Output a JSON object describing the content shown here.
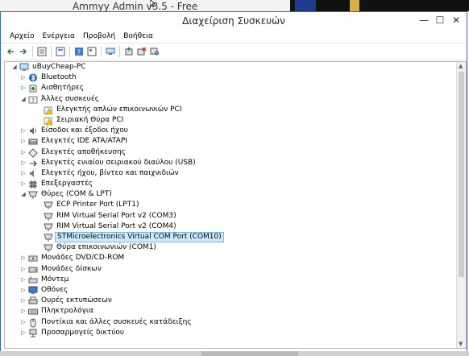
{
  "topstrip": {
    "text": "Ammyy Admin v3.5 - Free"
  },
  "window": {
    "title": "Διαχείριση Συσκευών",
    "min_glyph": "—",
    "max_glyph": "☐",
    "close_glyph": "✕"
  },
  "menu": [
    "Αρχείο",
    "Ενέργεια",
    "Προβολή",
    "Βοήθεια"
  ],
  "toolbar_icons": [
    "back-icon",
    "forward-icon",
    "sep",
    "properties-view-icon",
    "sep",
    "list-view-icon",
    "sep",
    "help-icon",
    "refresh-view-icon",
    "sep",
    "computer-icon",
    "sep",
    "update-driver-icon",
    "uninstall-icon",
    "scan-hardware-icon"
  ],
  "tree": [
    {
      "level": 0,
      "exp": "◢",
      "icon": "computer",
      "label": "uBuyCheap-PC"
    },
    {
      "level": 1,
      "exp": "▷",
      "icon": "bluetooth",
      "label": "Bluetooth"
    },
    {
      "level": 1,
      "exp": "▷",
      "icon": "sensor",
      "label": "Αισθητήρες"
    },
    {
      "level": 1,
      "exp": "◢",
      "icon": "unknown",
      "label": "Άλλες συσκευές"
    },
    {
      "level": 2,
      "exp": "",
      "icon": "warning",
      "label": "Ελεγκτής απλών επικοινωνιών PCI"
    },
    {
      "level": 2,
      "exp": "",
      "icon": "warning",
      "label": "Σειριακή Θύρα PCI"
    },
    {
      "level": 1,
      "exp": "▷",
      "icon": "audio-io",
      "label": "Είσοδοι και έξοδοι ήχου"
    },
    {
      "level": 1,
      "exp": "▷",
      "icon": "ide",
      "label": "Ελεγκτές IDE ATA/ATAPI"
    },
    {
      "level": 1,
      "exp": "▷",
      "icon": "storage",
      "label": "Ελεγκτές αποθήκευσης"
    },
    {
      "level": 1,
      "exp": "▷",
      "icon": "usb",
      "label": "Ελεγκτές ενιαίου σειριακού διαύλου (USB)"
    },
    {
      "level": 1,
      "exp": "▷",
      "icon": "sound",
      "label": "Ελεγκτές ήχου, βίντεο και παιχνιδιών"
    },
    {
      "level": 1,
      "exp": "▷",
      "icon": "cpu",
      "label": "Επεξεργαστές"
    },
    {
      "level": 1,
      "exp": "◢",
      "icon": "port",
      "label": "Θύρες (COM & LPT)"
    },
    {
      "level": 2,
      "exp": "",
      "icon": "port",
      "label": "ECP Printer Port (LPT1)"
    },
    {
      "level": 2,
      "exp": "",
      "icon": "port",
      "label": "RIM Virtual Serial Port v2 (COM3)"
    },
    {
      "level": 2,
      "exp": "",
      "icon": "port",
      "label": "RIM Virtual Serial Port v2 (COM4)"
    },
    {
      "level": 2,
      "exp": "",
      "icon": "port",
      "label": "STMicroelectronics Virtual COM Port (COM10)",
      "selected": true
    },
    {
      "level": 2,
      "exp": "",
      "icon": "port",
      "label": "Θύρα επικοινωνιών (COM1)"
    },
    {
      "level": 1,
      "exp": "▷",
      "icon": "dvd",
      "label": "Μονάδες DVD/CD-ROM"
    },
    {
      "level": 1,
      "exp": "▷",
      "icon": "disk",
      "label": "Μονάδες δίσκων"
    },
    {
      "level": 1,
      "exp": "▷",
      "icon": "modem",
      "label": "Μόντεμ"
    },
    {
      "level": 1,
      "exp": "▷",
      "icon": "monitor",
      "label": "Οθόνες"
    },
    {
      "level": 1,
      "exp": "▷",
      "icon": "printer",
      "label": "Ουρές εκτυπώσεων"
    },
    {
      "level": 1,
      "exp": "▷",
      "icon": "keyboard",
      "label": "Πληκτρολόγια"
    },
    {
      "level": 1,
      "exp": "▷",
      "icon": "mouse",
      "label": "Ποντίκια και άλλες συσκευές κατάδειξης"
    },
    {
      "level": 1,
      "exp": "▷",
      "icon": "network",
      "label": "Προσαρμογείς δικτύου"
    }
  ]
}
